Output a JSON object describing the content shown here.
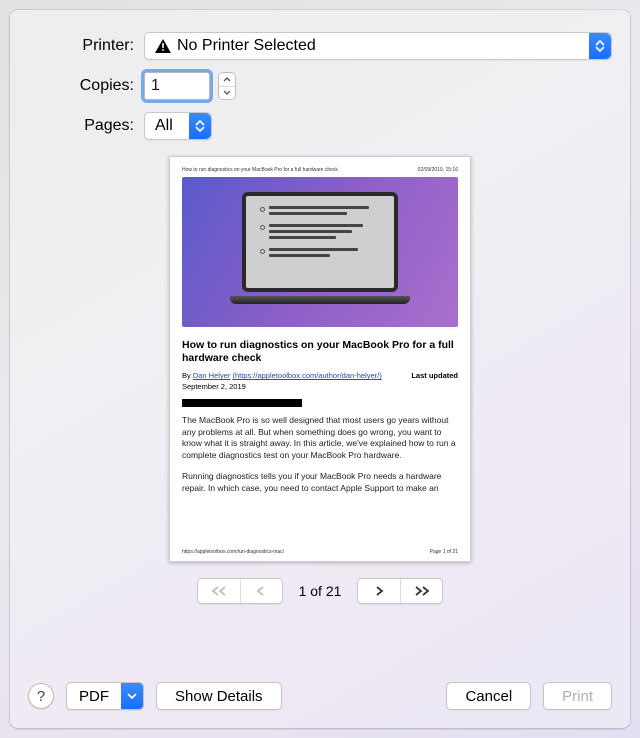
{
  "labels": {
    "printer": "Printer:",
    "copies": "Copies:",
    "pages": "Pages:"
  },
  "printer": {
    "selected": "No Printer Selected"
  },
  "copies": {
    "value": "1"
  },
  "pages": {
    "selected": "All"
  },
  "preview": {
    "header_left": "How to run diagnostics on your MacBook Pro for a full hardware check",
    "header_right": "02/09/2019, 15:16",
    "article_title": "How to run diagnostics on your MacBook Pro for a full hardware check",
    "byline_prefix": "By ",
    "author_name": "Dan Helyer",
    "author_url_text": "(https://appletoolbox.com/author/dan-helyer/)",
    "last_updated_label": "Last updated",
    "date": "September 2, 2019",
    "para1": "The MacBook Pro is so well designed that most users go years without any problems at all. But when something does go wrong, you want to know what it is straight away. In this article, we've explained how to run a complete diagnostics test on your MacBook Pro hardware.",
    "para2": "Running diagnostics tells you if your MacBook Pro needs a hardware repair. In which case, you need to contact Apple Support to make an",
    "footer_left": "https://appletoolbox.com/run-diagnostics-mac/",
    "footer_right": "Page 1 of 21"
  },
  "pager": {
    "text": "1 of 21"
  },
  "buttons": {
    "pdf": "PDF",
    "show_details": "Show Details",
    "cancel": "Cancel",
    "print": "Print",
    "help": "?"
  }
}
